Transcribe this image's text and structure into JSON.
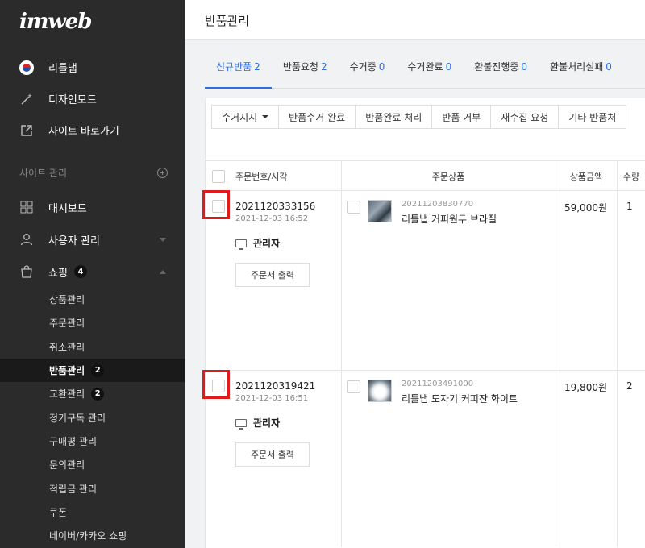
{
  "sidebar": {
    "logo": "imweb",
    "top_items": [
      {
        "label": "리틀냅",
        "icon": "korea-flag-icon"
      },
      {
        "label": "디자인모드",
        "icon": "magic-wand-icon"
      },
      {
        "label": "사이트 바로가기",
        "icon": "external-link-icon"
      }
    ],
    "section_title": "사이트 관리",
    "main_items": [
      {
        "label": "대시보드",
        "icon": "dashboard-grid-icon"
      },
      {
        "label": "사용자 관리",
        "icon": "user-icon"
      },
      {
        "label": "쇼핑",
        "icon": "shopping-bag-icon",
        "badge": "4"
      }
    ],
    "sub_items": [
      {
        "label": "상품관리"
      },
      {
        "label": "주문관리"
      },
      {
        "label": "취소관리"
      },
      {
        "label": "반품관리",
        "badge": "2"
      },
      {
        "label": "교환관리",
        "badge": "2"
      },
      {
        "label": "정기구독 관리"
      },
      {
        "label": "구매평 관리"
      },
      {
        "label": "문의관리"
      },
      {
        "label": "적립금 관리"
      },
      {
        "label": "쿠폰"
      },
      {
        "label": "네이버/카카오 쇼핑"
      }
    ]
  },
  "header": {
    "title": "반품관리"
  },
  "tabs": [
    {
      "label": "신규반품",
      "count": "2"
    },
    {
      "label": "반품요청",
      "count": "2"
    },
    {
      "label": "수거중",
      "count": "0"
    },
    {
      "label": "수거완료",
      "count": "0"
    },
    {
      "label": "환불진행중",
      "count": "0"
    },
    {
      "label": "환불처리실패",
      "count": "0"
    }
  ],
  "toolbar": {
    "buttons": [
      "수거지시",
      "반품수거 완료",
      "반품완료 처리",
      "반품 거부",
      "재수집 요청",
      "기타 반품처"
    ]
  },
  "table": {
    "headers": {
      "order": "주문번호/시각",
      "product": "주문상품",
      "price": "상품금액",
      "qty": "수량"
    },
    "rows": [
      {
        "order_no": "2021120333156",
        "order_time": "2021-12-03 16:52",
        "admin": "관리자",
        "print_label": "주문서 출력",
        "product_code": "20211203830770",
        "product_name": "리틀냅 커피원두 브라질",
        "price": "59,000원",
        "qty": "1"
      },
      {
        "order_no": "2021120319421",
        "order_time": "2021-12-03 16:51",
        "admin": "관리자",
        "print_label": "주문서 출력",
        "product_code": "20211203491000",
        "product_name": "리틀냅 도자기 커피잔 화이트",
        "price": "19,800원",
        "qty": "2"
      }
    ]
  },
  "colors": {
    "accent": "#2a6ee8",
    "highlight": "#e01b1b",
    "sidebar_bg": "#2b2b2b"
  }
}
